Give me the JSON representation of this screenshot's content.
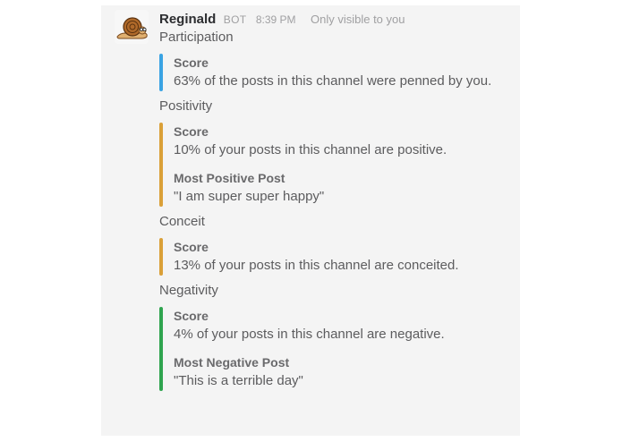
{
  "message": {
    "username": "Reginald",
    "bot_tag": "BOT",
    "timestamp": "8:39 PM",
    "visibility": "Only visible to you",
    "avatar_icon": "snail-icon"
  },
  "colors": {
    "participation": "#3aa3e3",
    "positivity": "#daa038",
    "conceit": "#daa038",
    "negativity": "#2fa44f"
  },
  "sections": [
    {
      "title": "Participation",
      "fields": [
        {
          "title": "Score",
          "value": "63% of the posts in this channel were penned by you."
        }
      ]
    },
    {
      "title": "Positivity",
      "fields": [
        {
          "title": "Score",
          "value": "10% of your posts in this channel are positive."
        },
        {
          "title": "Most Positive Post",
          "value": "\"I am super super happy\""
        }
      ]
    },
    {
      "title": "Conceit",
      "fields": [
        {
          "title": "Score",
          "value": "13% of your posts in this channel are conceited."
        }
      ]
    },
    {
      "title": "Negativity",
      "fields": [
        {
          "title": "Score",
          "value": "4% of your posts in this channel are negative."
        },
        {
          "title": "Most Negative Post",
          "value": "\"This is a terrible day\""
        }
      ]
    }
  ]
}
